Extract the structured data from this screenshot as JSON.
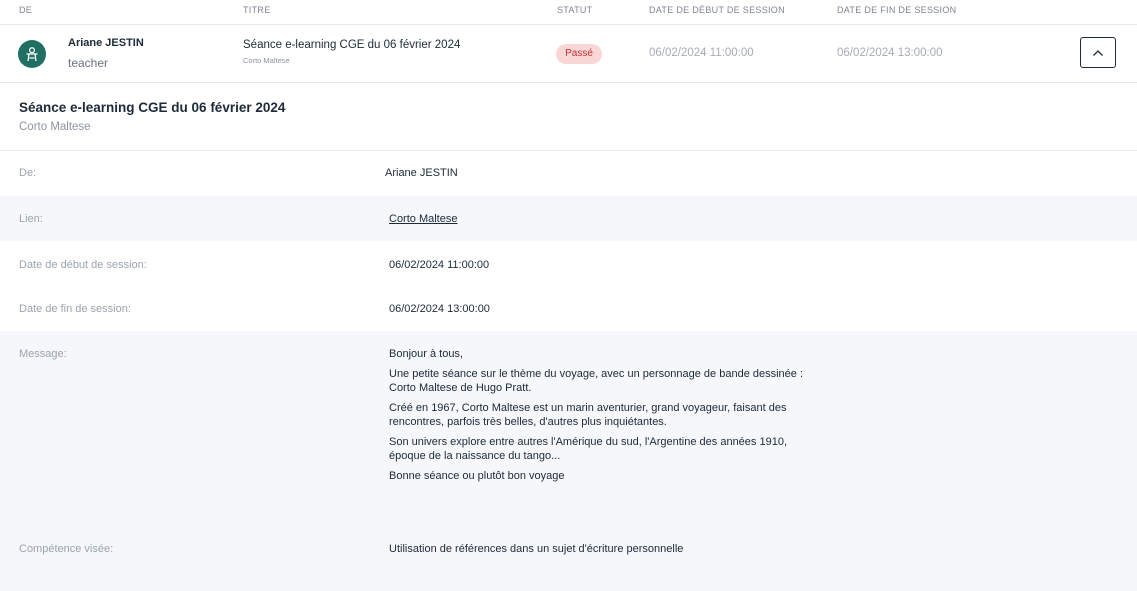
{
  "table": {
    "headers": {
      "from": "DE",
      "title": "TITRE",
      "status": "STATUT",
      "start": "DATE DE DÉBUT DE SESSION",
      "end": "DATE DE FIN DE SESSION"
    },
    "row": {
      "user_name": "Ariane JESTIN",
      "user_role": "teacher",
      "title": "Séance e-learning CGE du 06 février 2024",
      "subtitle": "Corto Maltese",
      "status": "Passé",
      "start": "06/02/2024 11:00:00",
      "end": "06/02/2024 13:00:00"
    }
  },
  "detail": {
    "title": "Séance e-learning CGE du 06 février 2024",
    "subtitle": "Corto Maltese",
    "fields": {
      "from_label": "De:",
      "from_value": "Ariane JESTIN",
      "link_label": "Lien:",
      "link_value": "Corto Maltese",
      "start_label": "Date de début de session:",
      "start_value": "06/02/2024 11:00:00",
      "end_label": "Date de fin de session:",
      "end_value": "06/02/2024 13:00:00",
      "message_label": "Message:",
      "message_lines": [
        "Bonjour à tous,",
        "Une petite séance sur le thème du voyage, avec un personnage de bande dessinée : Corto Maltese de Hugo Pratt.",
        "Créé en 1967, Corto Maltese est un marin aventurier, grand voyageur, faisant des rencontres, parfois très belles, d'autres plus inquiétantes.",
        "Son univers explore entre autres l'Amérique du sud, l'Argentine des années 1910, époque de la naissance du tango...",
        "Bonne séance ou plutôt bon voyage"
      ],
      "skill_label": "Compétence visée:",
      "skill_value": "Utilisation de références dans un sujet d'écriture personnelle"
    }
  },
  "icons": {
    "avatar": "teacher-avatar-icon",
    "collapse": "chevron-up-icon"
  },
  "colors": {
    "avatar_bg": "#1f6f62",
    "badge_bg": "#fad7d7",
    "badge_text": "#c53030"
  }
}
